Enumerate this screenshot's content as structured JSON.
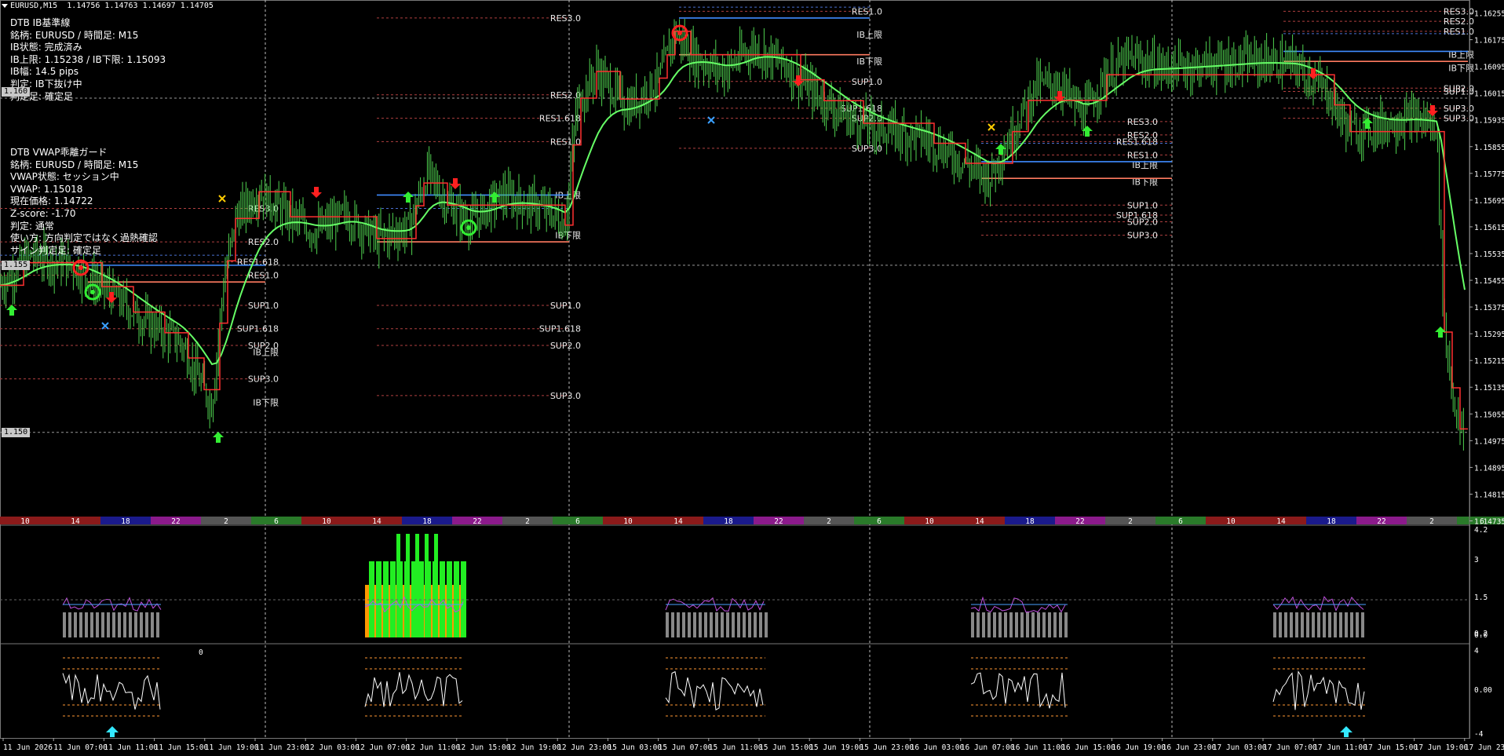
{
  "header": {
    "symbol": "EURUSD,M15",
    "ohlc": "1.14756 1.14763 1.14697 1.14705"
  },
  "ib_panel": {
    "title": "DTB IB基準線",
    "symbol_line": "銘柄: EURUSD / 時間足: M15",
    "status": "IB状態: 完成済み",
    "bounds": "IB上限: 1.15238 / IB下限: 1.15093",
    "width": "IB幅: 14.5 pips",
    "judge": "判定: IB下抜け中",
    "mode": "判定足: 確定足"
  },
  "vwap_panel": {
    "title": "DTB VWAP乖離ガード",
    "symbol_line": "銘柄: EURUSD / 時間足: M15",
    "status": "VWAP状態: セッション中",
    "vwap": "VWAP: 1.15018",
    "price": "現在価格: 1.14722",
    "zscore": "Z-score: -1.70",
    "judge": "判定: 通常",
    "usage": "使い方: 方向判定ではなく過熱確認",
    "sign": "サイン判定足: 確定足"
  },
  "left_price_boxes": [
    {
      "label": "1.160",
      "price": 1.1602
    },
    {
      "label": "1.155",
      "price": 1.155
    },
    {
      "label": "1.150",
      "price": 1.15
    }
  ],
  "price_axis": {
    "labels": [
      "1.16255",
      "1.16175",
      "1.16095",
      "1.16015",
      "1.15935",
      "1.15855",
      "1.15775",
      "1.15695",
      "1.15615",
      "1.15535",
      "1.15455",
      "1.15375",
      "1.15295",
      "1.15215",
      "1.15135",
      "1.15055",
      "1.14975",
      "1.14895",
      "1.14815",
      "1.14735"
    ]
  },
  "sub1_axis": [
    "4.2",
    "3",
    "1.5",
    "0.2",
    "0.0"
  ],
  "sub2_axis": [
    "4",
    "0.00",
    "-4"
  ],
  "sub2_label": "0",
  "time_axis": [
    "11 Jun 2026",
    "11 Jun 07:00",
    "11 Jun 11:00",
    "11 Jun 15:00",
    "11 Jun 19:00",
    "11 Jun 23:00",
    "12 Jun 03:00",
    "12 Jun 07:00",
    "12 Jun 11:00",
    "12 Jun 15:00",
    "12 Jun 19:00",
    "12 Jun 23:00",
    "15 Jun 03:00",
    "15 Jun 07:00",
    "15 Jun 11:00",
    "15 Jun 15:00",
    "15 Jun 19:00",
    "15 Jun 23:00",
    "16 Jun 03:00",
    "16 Jun 07:00",
    "16 Jun 11:00",
    "16 Jun 15:00",
    "16 Jun 19:00",
    "16 Jun 23:00",
    "17 Jun 03:00",
    "17 Jun 07:00",
    "17 Jun 11:00",
    "17 Jun 15:00",
    "17 Jun 19:00",
    "17 Jun 23:00"
  ],
  "hour_bar": {
    "cycle": [
      "10",
      "14",
      "18",
      "22",
      "2",
      "6"
    ],
    "colors": [
      "#8b1a1a",
      "#8b1a1a",
      "#1a1a8b",
      "#8b1a8b",
      "#555555",
      "#2a7a2a"
    ]
  },
  "colors": {
    "up_candle": "#4fd24f",
    "ib_high": "#3f8cff",
    "ib_low": "#ff7a60",
    "vwap_fast": "#ff3030",
    "vwap_line": "#66ff66",
    "dotted_blue": "#4a6fd0",
    "dotted_red": "#b04040",
    "arrow_up": "#33ee33",
    "arrow_down": "#ff2020",
    "cyan_arrow": "#33e8ff"
  },
  "level_labels": {
    "d1": [
      [
        "RES3.0",
        1.1567
      ],
      [
        "RES2.0",
        1.1557
      ],
      [
        "RES1.618",
        1.1551
      ],
      [
        "RES1.0",
        1.1547
      ],
      [
        "IB上限",
        1.1524
      ],
      [
        "IB下限",
        1.1509
      ],
      [
        "SUP1.0",
        1.1538
      ],
      [
        "SUP1.618",
        1.1531
      ],
      [
        "SUP2.0",
        1.1526
      ],
      [
        "SUP3.0",
        1.1516
      ]
    ],
    "d2": [
      [
        "RES3.0",
        1.1624
      ],
      [
        "RES2.0",
        1.1601
      ],
      [
        "RES1.618",
        1.1594
      ],
      [
        "RES1.0",
        1.1587
      ],
      [
        "IB上限",
        1.1571
      ],
      [
        "IB下限",
        1.1559
      ],
      [
        "SUP1.0",
        1.1538
      ],
      [
        "SUP1.618",
        1.1531
      ],
      [
        "SUP2.0",
        1.1526
      ],
      [
        "SUP3.0",
        1.1511
      ]
    ],
    "d3": [
      [
        "RES1.0",
        1.1626
      ],
      [
        "IB上限",
        1.1619
      ],
      [
        "IB下限",
        1.1611
      ],
      [
        "SUP1.0",
        1.1605
      ],
      [
        "SUP1.618",
        1.1597
      ],
      [
        "SUP2.0",
        1.1594
      ],
      [
        "SUP3.0",
        1.1585
      ]
    ],
    "d4": [
      [
        "RES3.0",
        1.1593
      ],
      [
        "RES2.0",
        1.1589
      ],
      [
        "RES1.618",
        1.1587
      ],
      [
        "RES1.0",
        1.1583
      ],
      [
        "IB上限",
        1.158
      ],
      [
        "IB下限",
        1.1575
      ],
      [
        "SUP1.0",
        1.1568
      ],
      [
        "SUP1.618",
        1.1565
      ],
      [
        "SUP2.0",
        1.1563
      ],
      [
        "SUP3.0",
        1.1559
      ]
    ],
    "d5": [
      [
        "RES3.0",
        1.1626
      ],
      [
        "RES2.0",
        1.1623
      ],
      [
        "RES1.0",
        1.162
      ],
      [
        "IB上限",
        1.1613
      ],
      [
        "IB下限",
        1.1609
      ],
      [
        "SUP2.0",
        1.1603
      ],
      [
        "SUP1.0",
        1.1602
      ],
      [
        "SUP3.0",
        1.1597
      ],
      [
        "SUP3.0",
        1.1594
      ]
    ]
  }
}
